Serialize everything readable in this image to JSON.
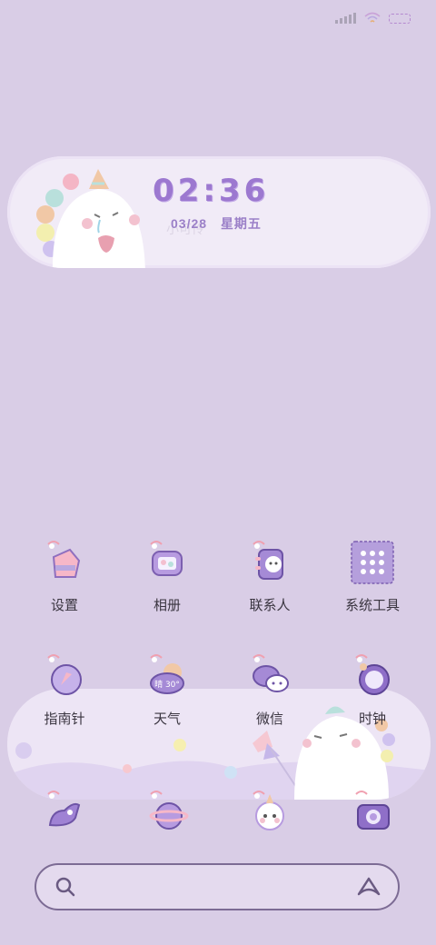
{
  "clock": {
    "time": "02:36",
    "date": "03/28",
    "weekday": "星期五",
    "faint_text": "小可怜"
  },
  "apps_row1": [
    {
      "label": "设置",
      "icon": "settings-icon"
    },
    {
      "label": "相册",
      "icon": "gallery-icon"
    },
    {
      "label": "联系人",
      "icon": "contacts-icon"
    },
    {
      "label": "系统工具",
      "icon": "system-tools-icon"
    }
  ],
  "apps_row2": [
    {
      "label": "指南针",
      "icon": "compass-icon"
    },
    {
      "label": "天气",
      "icon": "weather-icon"
    },
    {
      "label": "微信",
      "icon": "wechat-icon"
    },
    {
      "label": "时钟",
      "icon": "clock-icon"
    }
  ],
  "weather_badge": "晴 30°",
  "dock": [
    {
      "icon": "unicorn-app-icon"
    },
    {
      "icon": "planet-app-icon"
    },
    {
      "icon": "unicorn-face-app-icon"
    },
    {
      "icon": "camera-icon"
    }
  ],
  "colors": {
    "background": "#d9cde6",
    "accent": "#9c78d0",
    "text": "#3a3540"
  }
}
